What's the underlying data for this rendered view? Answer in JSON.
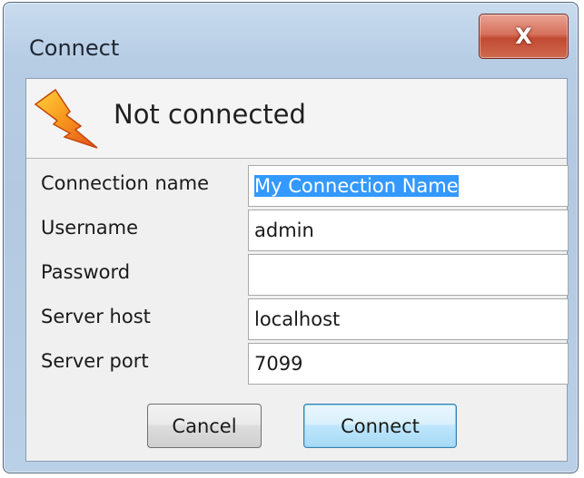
{
  "window": {
    "title": "Connect",
    "close_glyph": "X"
  },
  "status": {
    "icon": "lightning-bolt-icon",
    "text": "Not connected"
  },
  "form": {
    "fields": [
      {
        "label": "Connection name",
        "value": "My Connection Name"
      },
      {
        "label": "Username",
        "value": "admin"
      },
      {
        "label": "Password",
        "value": ""
      },
      {
        "label": "Server host",
        "value": "localhost"
      },
      {
        "label": "Server port",
        "value": "7099"
      }
    ]
  },
  "buttons": {
    "cancel_label": "Cancel",
    "connect_label": "Connect"
  },
  "colors": {
    "selection": "#3399ff",
    "close_button": "#c24a32",
    "icon_orange": "#f28c1b"
  }
}
